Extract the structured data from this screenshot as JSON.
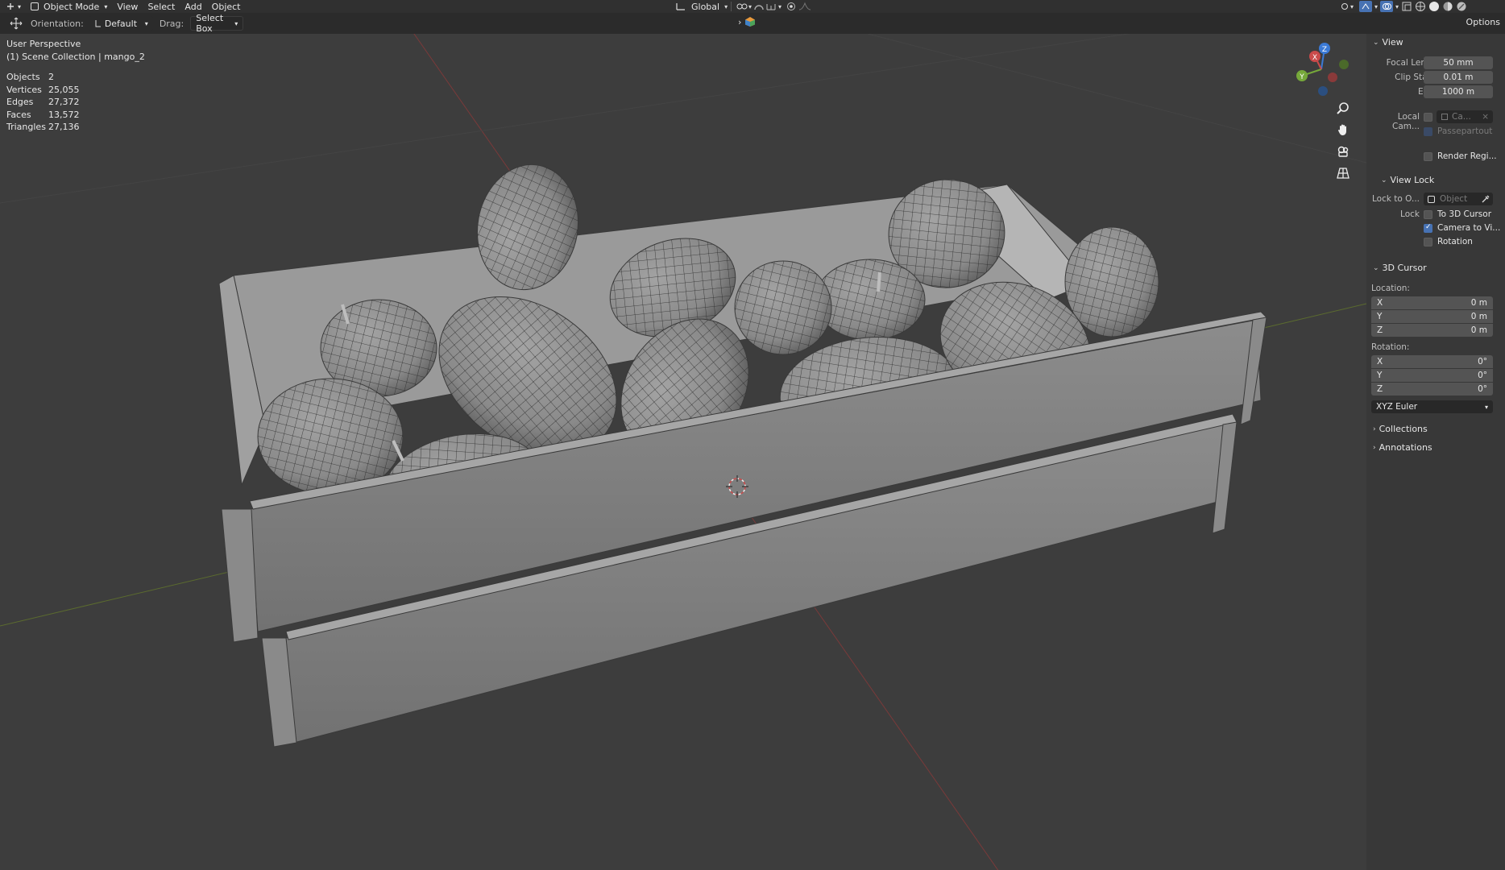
{
  "header": {
    "mode": "Object Mode",
    "menus": [
      "View",
      "Select",
      "Add",
      "Object"
    ],
    "transform_orientation": "Global",
    "options_label": "Options"
  },
  "toolrow": {
    "orientation_label": "Orientation:",
    "orientation_value": "Default",
    "drag_label": "Drag:",
    "drag_value": "Select Box"
  },
  "overlay": {
    "view_name": "User Perspective",
    "collection": "(1) Scene Collection | mango_2",
    "stats": [
      {
        "k": "Objects",
        "v": "2"
      },
      {
        "k": "Vertices",
        "v": "25,055"
      },
      {
        "k": "Edges",
        "v": "27,372"
      },
      {
        "k": "Faces",
        "v": "13,572"
      },
      {
        "k": "Triangles",
        "v": "27,136"
      }
    ]
  },
  "gizmo": {
    "x": "X",
    "y": "Y",
    "z": "Z"
  },
  "npanel": {
    "view_header": "View",
    "focal_label": "Focal Len...",
    "focal_value": "50 mm",
    "clip_start_label": "Clip Start",
    "clip_start_value": "0.01 m",
    "end_label": "End",
    "end_value": "1000 m",
    "local_cam_label": "Local Cam...",
    "local_cam_value": "Ca...",
    "passepartout": "Passepartout",
    "render_region": "Render Regi...",
    "view_lock_header": "View Lock",
    "lock_to_label": "Lock to O...",
    "lock_to_placeholder": "Object",
    "lock_label": "Lock",
    "to_3d_cursor": "To 3D Cursor",
    "camera_to_view": "Camera to Vi...",
    "rotation_cb": "Rotation",
    "cursor_header": "3D Cursor",
    "location_label": "Location:",
    "loc": [
      {
        "axis": "X",
        "value": "0 m"
      },
      {
        "axis": "Y",
        "value": "0 m"
      },
      {
        "axis": "Z",
        "value": "0 m"
      }
    ],
    "rotation_label": "Rotation:",
    "rot": [
      {
        "axis": "X",
        "value": "0°"
      },
      {
        "axis": "Y",
        "value": "0°"
      },
      {
        "axis": "Z",
        "value": "0°"
      }
    ],
    "rotation_mode": "XYZ Euler",
    "collections_header": "Collections",
    "annotations_header": "Annotations"
  }
}
